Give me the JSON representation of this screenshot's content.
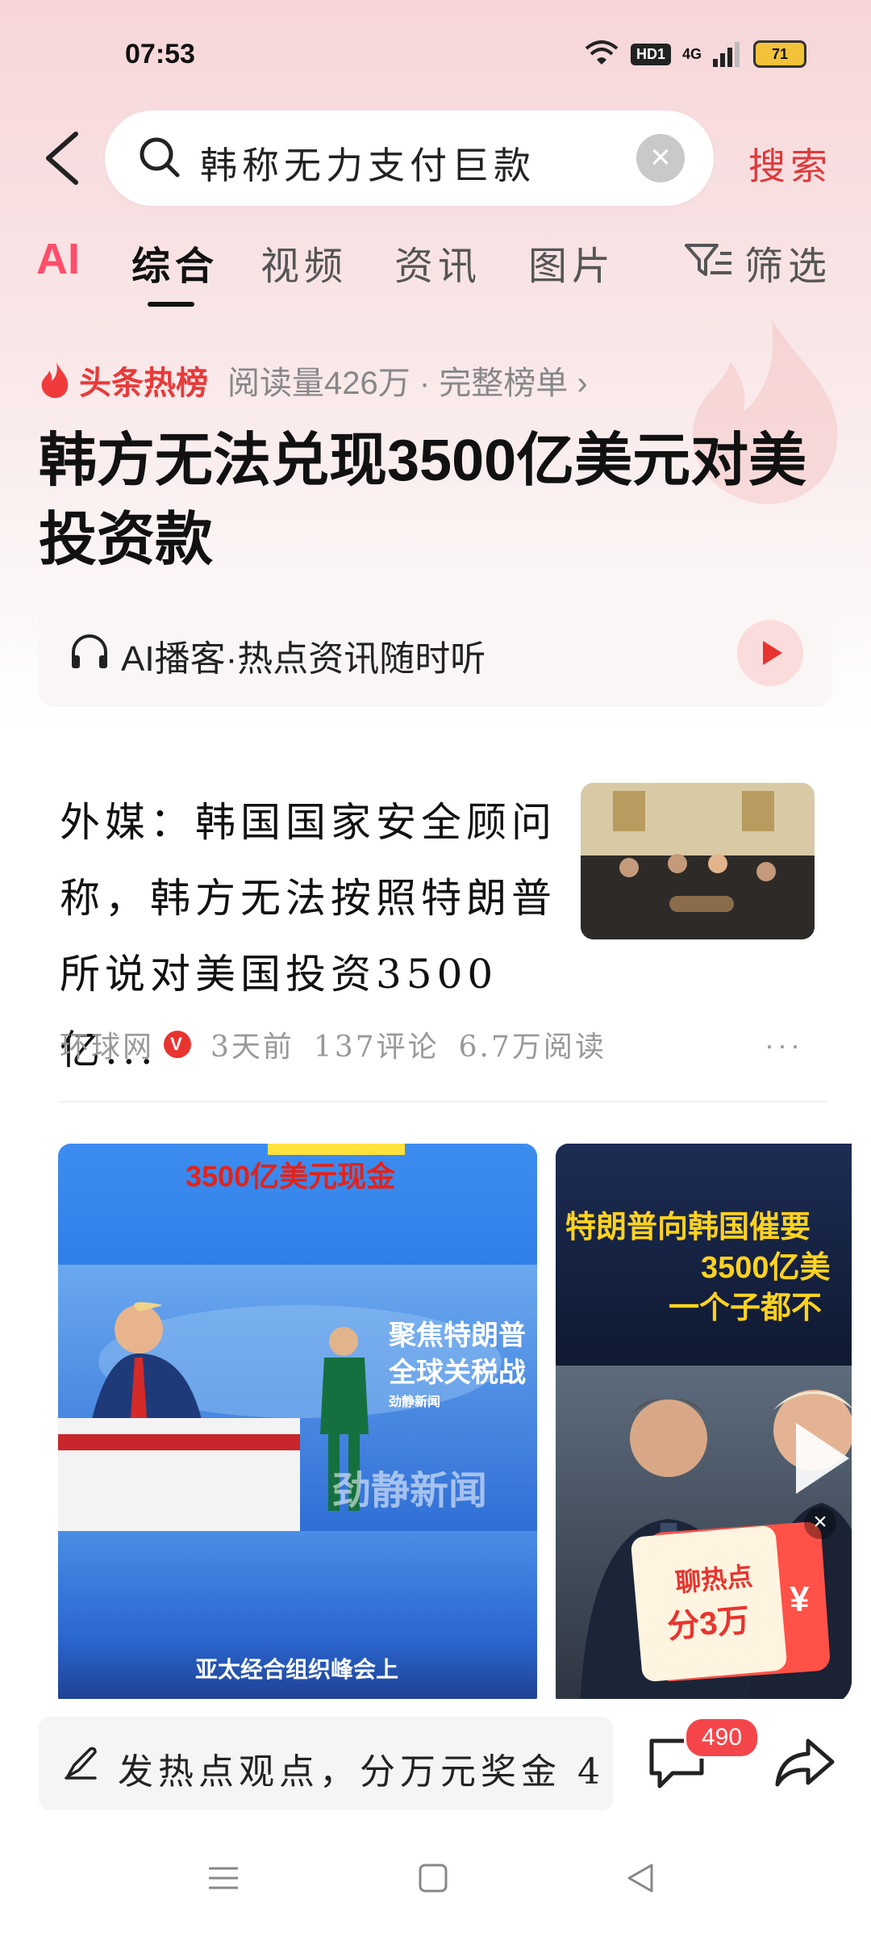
{
  "status_bar": {
    "time": "07:53",
    "network": "4G",
    "hd": "HD1",
    "battery": "71"
  },
  "search": {
    "query": "韩称无力支付巨款",
    "button_label": "搜索"
  },
  "tabs": [
    {
      "label": "AI"
    },
    {
      "label": "综合",
      "active": true
    },
    {
      "label": "视频"
    },
    {
      "label": "资讯"
    },
    {
      "label": "图片"
    },
    {
      "label": "筛选"
    }
  ],
  "hot": {
    "label": "头条热榜",
    "meta": "阅读量426万 · 完整榜单 ›"
  },
  "headline": "韩方无法兑现3500亿美元对美投资款",
  "podcast": {
    "text": "AI播客·热点资讯随时听"
  },
  "article": {
    "title": "外媒：韩国国家安全顾问称，韩方无法按照特朗普所说对美国投资3500亿...",
    "source": "环球网",
    "verified_badge": "V",
    "time": "3天前",
    "comments": "137评论",
    "reads": "6.7万阅读",
    "more": "···"
  },
  "videos": [
    {
      "top_caption": "3500亿美元现金",
      "side_caption_1": "聚焦特朗普",
      "side_caption_2": "全球关税战",
      "logo": "劲静新闻",
      "small_logo": "劲静新闻",
      "bottom_caption": "亚太经合组织峰会上"
    },
    {
      "caption_1": "特朗普向韩国催要",
      "caption_2": "3500亿美",
      "caption_3": "一个子都不",
      "promo_1": "聊热点",
      "promo_2": "分3万",
      "promo_symbol": "¥"
    }
  ],
  "bottom": {
    "comment_placeholder": "发热点观点，分万元奖金 4.",
    "comment_count": "490"
  },
  "colors": {
    "accent": "#e83a3a",
    "ai_tab": "#ff4d6a",
    "badge": "#f4464a"
  },
  "icons": [
    "back-arrow-icon",
    "search-icon",
    "clear-icon",
    "filter-icon",
    "flame-icon",
    "headphones-icon",
    "play-icon",
    "pen-icon",
    "chat-icon",
    "share-icon",
    "nav-menu-icon",
    "nav-home-icon",
    "nav-back-icon"
  ]
}
